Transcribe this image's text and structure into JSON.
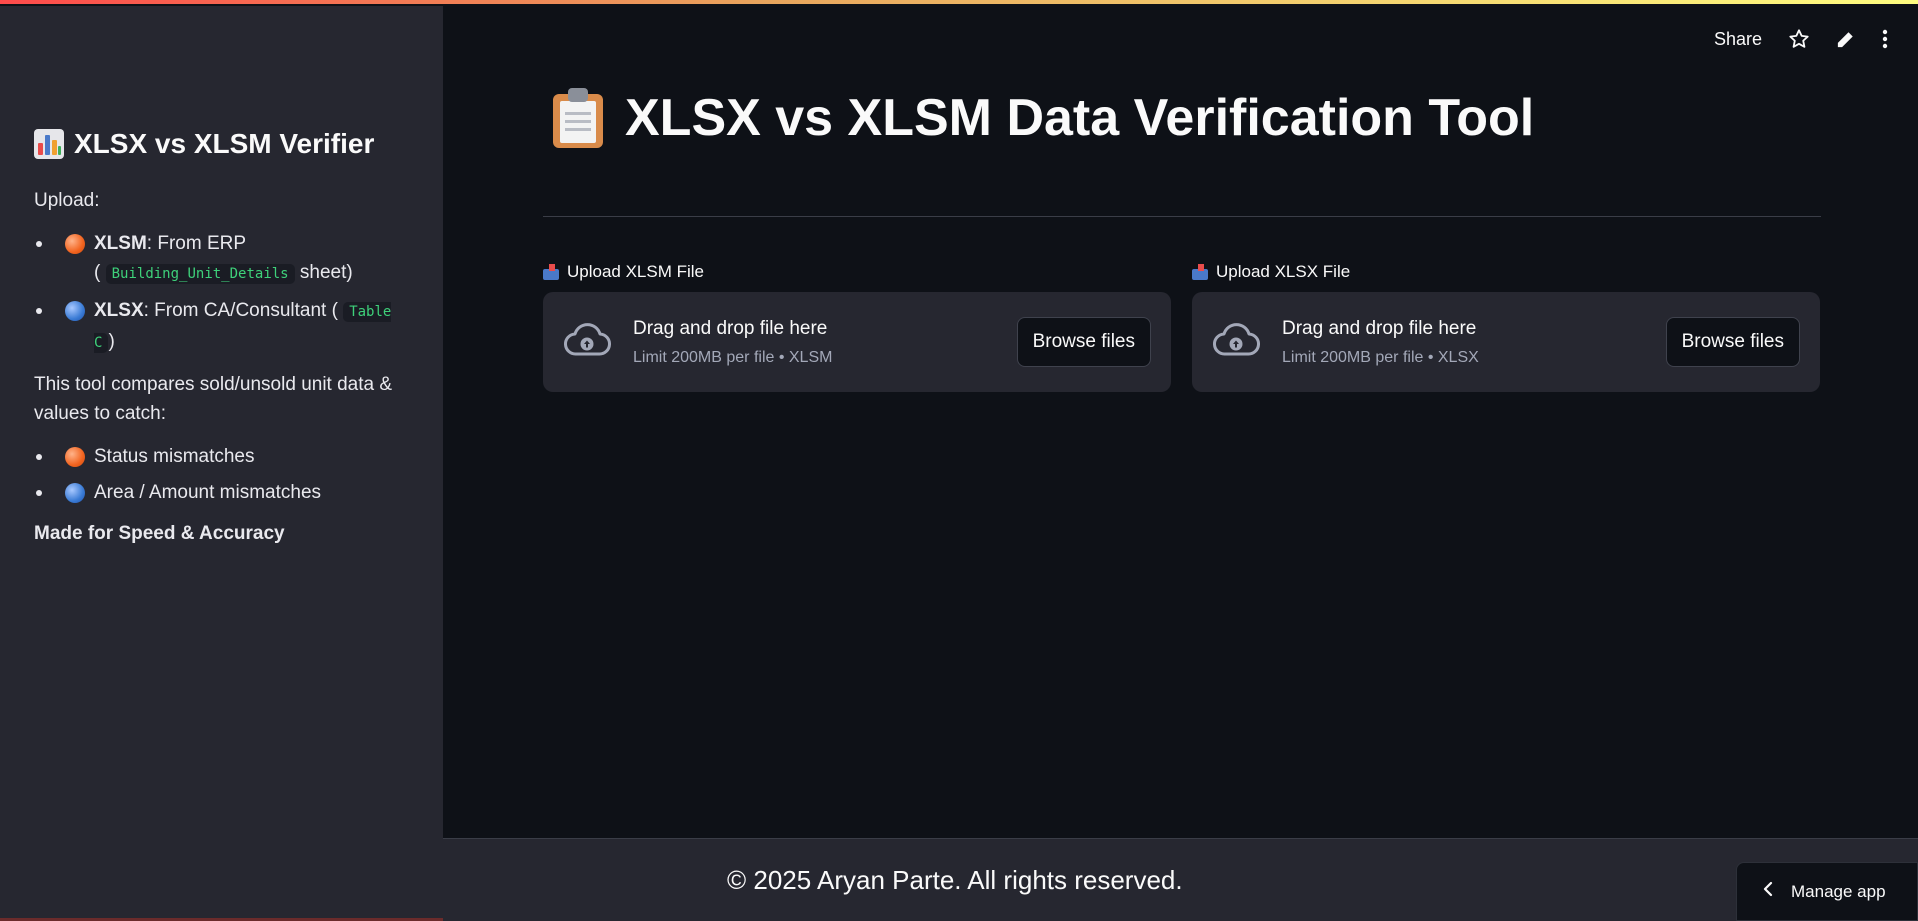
{
  "sidebar": {
    "title": "XLSX vs XLSM Verifier",
    "upload_label": "Upload:",
    "items": [
      {
        "bold": "XLSM",
        "text_before": ": From ERP",
        "paren_open": "(",
        "code": "Building_Unit_Details",
        "text_after": " sheet)"
      },
      {
        "bold": "XLSX",
        "text_before": ": From CA/Consultant (",
        "code": "Table C",
        "text_after": ")"
      }
    ],
    "description": "This tool compares sold/unsold unit data & values to catch:",
    "catches": [
      "Status mismatches",
      "Area / Amount mismatches"
    ],
    "made_for": "Made for Speed & Accuracy"
  },
  "header": {
    "share_label": "Share"
  },
  "main": {
    "title": "XLSX vs XLSM Data Verification Tool",
    "uploads": [
      {
        "label": "Upload XLSM File",
        "drag_text": "Drag and drop file here",
        "limit_text": "Limit 200MB per file • XLSM",
        "button": "Browse files"
      },
      {
        "label": "Upload XLSX File",
        "drag_text": "Drag and drop file here",
        "limit_text": "Limit 200MB per file • XLSX",
        "button": "Browse files"
      }
    ]
  },
  "footer": {
    "copyright": "© 2025 Aryan Parte. All rights reserved."
  },
  "manage_app": {
    "label": "Manage app"
  },
  "colors": {
    "background": "#0e1117",
    "sidebar": "#262730",
    "code_text": "#3ed17a"
  }
}
